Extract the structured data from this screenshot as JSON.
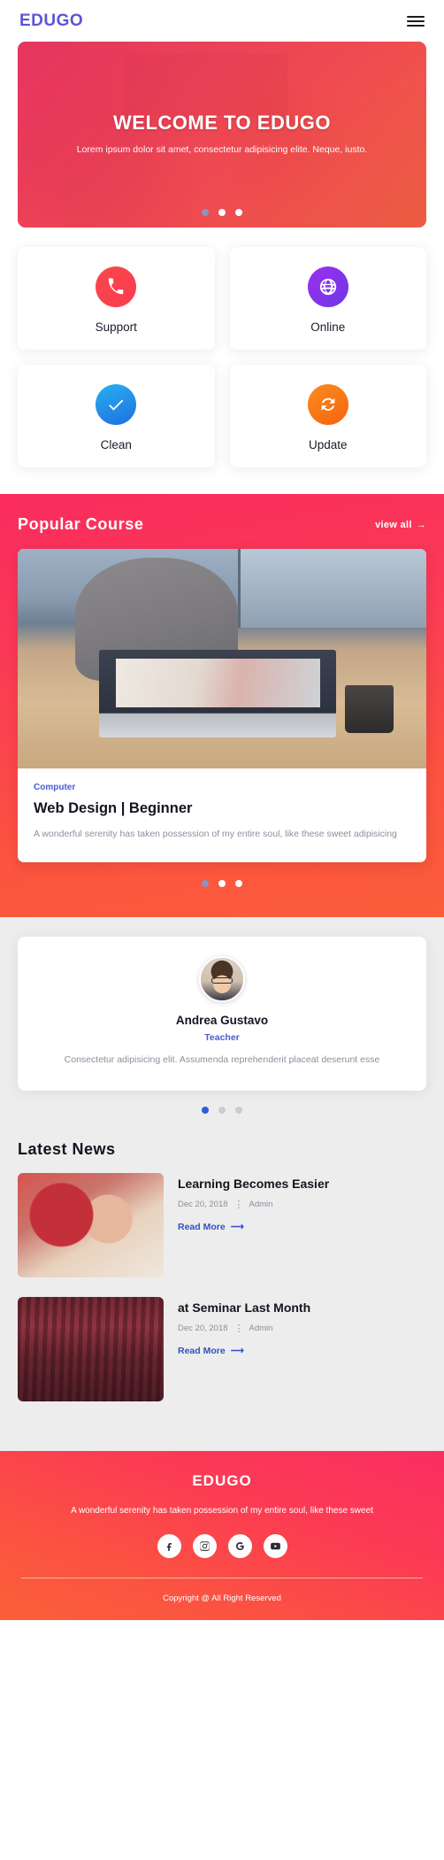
{
  "header": {
    "logo": "EDUGO",
    "menu_icon": "hamburger-icon"
  },
  "hero": {
    "title": "WELCOME TO EDUGO",
    "subtitle": "Lorem ipsum dolor sit amet, consectetur adipisicing elite. Neque, iusto.",
    "dots": 3,
    "active_dot": 1
  },
  "services": [
    {
      "label": "Support",
      "icon": "phone-icon",
      "color_from": "#f9484a",
      "color_to": "#fb3b53"
    },
    {
      "label": "Online",
      "icon": "globe-icon",
      "color_from": "#9b2ff0",
      "color_to": "#6e37e6"
    },
    {
      "label": "Clean",
      "icon": "check-icon",
      "color_from": "#27b0f0",
      "color_to": "#1f6fe0"
    },
    {
      "label": "Update",
      "icon": "refresh-icon",
      "color_from": "#fb8b1e",
      "color_to": "#f4650f"
    }
  ],
  "popular": {
    "title": "Popular Course",
    "view_all": "view all",
    "view_all_icon": "arrow-right-icon",
    "course": {
      "category": "Computer",
      "title": "Web Design | Beginner",
      "description": "A wonderful serenity has taken possession of my entire soul, like these sweet adipisicing",
      "image": "laptop-on-desk-photo"
    },
    "dots": 3,
    "active_dot": 1
  },
  "testimonial": {
    "avatar": "avatar-photo",
    "name": "Andrea Gustavo",
    "role": "Teacher",
    "text": "Consectetur adipisicing elit. Assumenda reprehenderit placeat deserunt esse",
    "dots": 3,
    "active_dot": 1
  },
  "news": {
    "title": "Latest News",
    "items": [
      {
        "title": "Learning Becomes Easier",
        "date": "Dec 20, 2018",
        "author": "Admin",
        "read_more": "Read More",
        "read_more_icon": "arrow-right-icon",
        "thumb": "children-writing-photo"
      },
      {
        "title": "at Seminar Last Month",
        "date": "Dec 20, 2018",
        "author": "Admin",
        "read_more": "Read More",
        "read_more_icon": "arrow-right-icon",
        "thumb": "seminar-audience-photo"
      }
    ]
  },
  "footer": {
    "logo": "EDUGO",
    "description": "A wonderful serenity has taken possession of my entire soul, like these sweet",
    "socials": [
      {
        "name": "facebook-icon"
      },
      {
        "name": "instagram-icon"
      },
      {
        "name": "google-icon"
      },
      {
        "name": "youtube-icon"
      }
    ],
    "copyright": "Copyright @ All Right Reserved"
  },
  "colors": {
    "brand_purple": "#5b55d6",
    "accent_pink": "#fb2e62",
    "accent_orange": "#fb5f38",
    "link_blue": "#3450c4"
  }
}
